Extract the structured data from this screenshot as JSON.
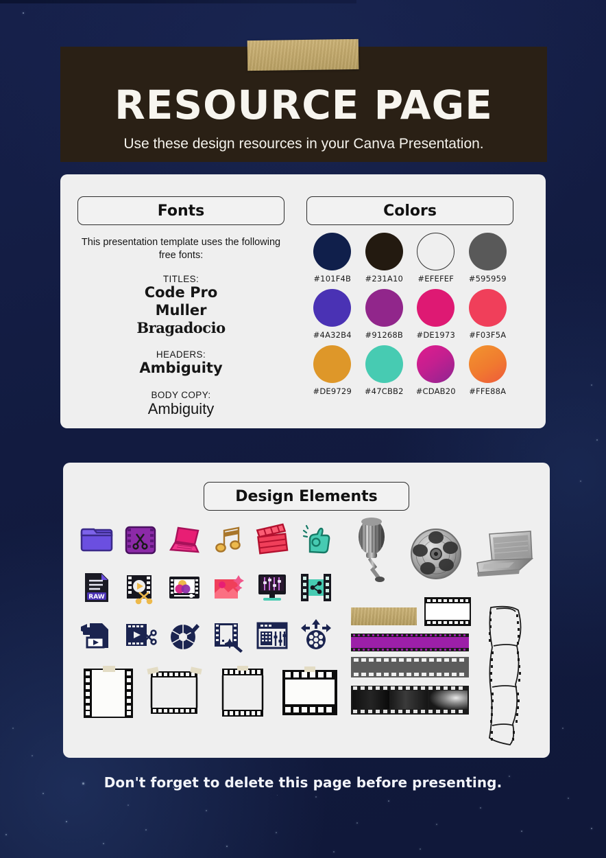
{
  "header": {
    "title": "RESOURCE PAGE",
    "subtitle": "Use these design resources in your Canva Presentation.",
    "tape_name": "masking-tape"
  },
  "fonts_panel": {
    "pill_label": "Fonts",
    "intro": "This presentation template uses the following free fonts:",
    "groups": [
      {
        "label": "TITLES:",
        "names": [
          "Code Pro",
          "Muller",
          "Bragadocio"
        ]
      },
      {
        "label": "HEADERS:",
        "names": [
          "Ambiguity"
        ]
      },
      {
        "label": "BODY COPY:",
        "names": [
          "Ambiguity"
        ]
      }
    ]
  },
  "colors_panel": {
    "pill_label": "Colors",
    "swatches": [
      {
        "hex": "#101F4B",
        "label": "#101F4B",
        "style": "solid"
      },
      {
        "hex": "#231A10",
        "label": "#231A10",
        "style": "solid"
      },
      {
        "hex": "#EFEFEF",
        "label": "#EFEFEF",
        "style": "outlined"
      },
      {
        "hex": "#595959",
        "label": "#595959",
        "style": "solid"
      },
      {
        "hex": "#4A32B4",
        "label": "#4A32B4",
        "style": "solid"
      },
      {
        "hex": "#91268B",
        "label": "#91268B",
        "style": "solid"
      },
      {
        "hex": "#DE1973",
        "label": "#DE1973",
        "style": "solid"
      },
      {
        "hex": "#F03F5A",
        "label": "#F03F5A",
        "style": "solid"
      },
      {
        "hex": "#DE9729",
        "label": "#DE9729",
        "style": "solid"
      },
      {
        "hex": "#47CBB2",
        "label": "#47CBB2",
        "style": "solid"
      },
      {
        "hex": "#CDAB20",
        "label": "#CDAB20",
        "style": "gradient-magenta"
      },
      {
        "hex": "#FFE88A",
        "label": "#FFE88A",
        "style": "gradient-orange"
      }
    ]
  },
  "elements_panel": {
    "pill_label": "Design Elements",
    "icon_rows": [
      [
        "folder-icon",
        "film-scissors-icon",
        "laptop-icon",
        "music-note-icon",
        "clapperboard-icon",
        "ok-hand-icon"
      ],
      [
        "raw-file-icon",
        "film-play-scissors-icon",
        "video-player-icon",
        "image-sparkle-icon",
        "monitor-equalizer-icon",
        "film-share-icon"
      ],
      [
        "video-file-icon",
        "film-cut-icon",
        "camera-shutter-icon",
        "film-magic-wand-icon",
        "mixer-panel-icon",
        "film-reel-arrows-icon"
      ]
    ],
    "film_frames": [
      "film-frame-tall",
      "film-frame-taped",
      "film-frame-narrow",
      "film-frame-wide"
    ],
    "photo_items": [
      "vintage-microphone-photo",
      "film-reel-photo",
      "laptop-photo"
    ],
    "strip_items": [
      "tape-strip",
      "film-frame-outline",
      "purple-film-strip",
      "gray-film-strip",
      "photo-film-strip",
      "wavy-film-strip"
    ]
  },
  "footer": {
    "note": "Don't forget to delete this page before presenting."
  },
  "theme": {
    "background": "#131C42",
    "card": "#EFEFEF",
    "header_block": "#2A2015",
    "tape": "#C3A96C",
    "text_light": "#F7F5EF",
    "text_dark": "#161616"
  }
}
